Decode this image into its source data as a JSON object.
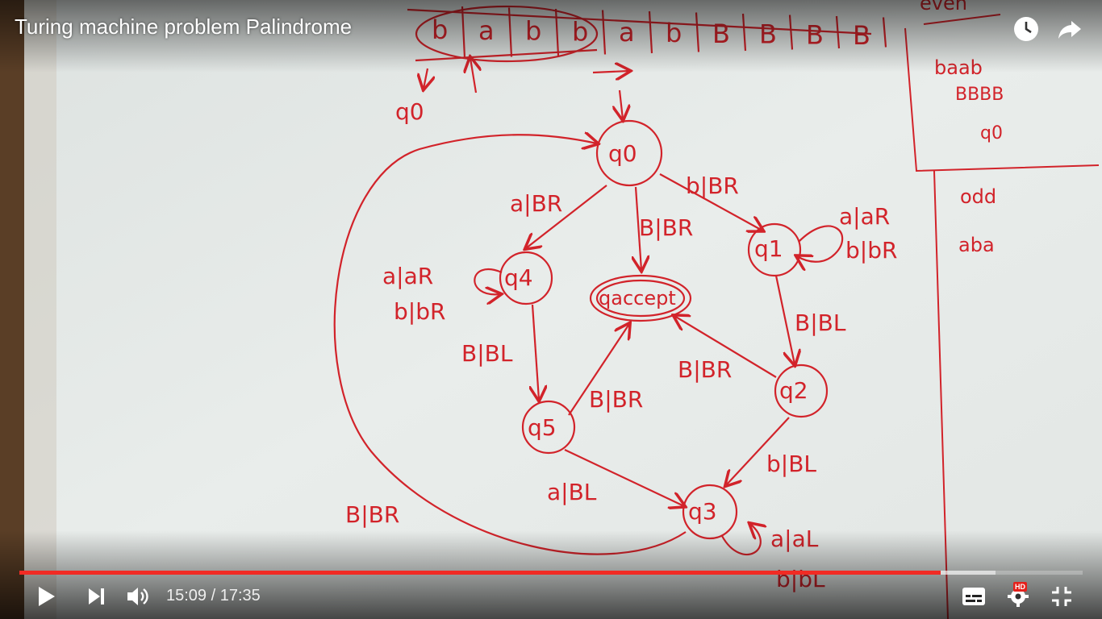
{
  "video": {
    "title": "Turing machine problem Palindrome",
    "progress_fraction": 0.8662,
    "buffered_fraction": 0.918
  },
  "controls": {
    "current_time": "15:09",
    "separator": " / ",
    "duration": "17:35",
    "hd_badge": "HD"
  },
  "colors": {
    "ink": "#d2232a",
    "progress": "#f12b24",
    "board": "#e7ecea"
  },
  "board": {
    "tape_cells": [
      "b",
      "a",
      "b",
      "b",
      "a",
      "b",
      "B",
      "B",
      "B",
      "B"
    ],
    "tape_head_label": "q0",
    "states": {
      "q0": "q0",
      "q1": "q1",
      "q2": "q2",
      "q3": "q3",
      "q4": "q4",
      "q5": "q5",
      "qaccept": "qaccept"
    },
    "transitions": {
      "q0_q4": "a|BR",
      "q0_q1": "b|BR",
      "q0_acc": "B|BR",
      "q1_loop_a": "a|aR",
      "q1_loop_b": "b|bR",
      "q4_loop_a": "a|aR",
      "q4_loop_b": "b|bR",
      "q1_q2": "B|BL",
      "q4_q5": "B|BL",
      "q5_acc": "B|BR",
      "q2_acc": "B|BR",
      "q2_q3": "b|BL",
      "q5_q3": "a|BL",
      "q3_loop_a": "a|aL",
      "q3_loop_b": "b|bL",
      "q3_q0": "B|BR"
    },
    "side_note_top": "even",
    "side_note_cells": "baab",
    "side_note_tape": "BBBB",
    "side_note_state": "q0",
    "side_note_odd": "odd",
    "side_note_odd_cells": "aba"
  }
}
